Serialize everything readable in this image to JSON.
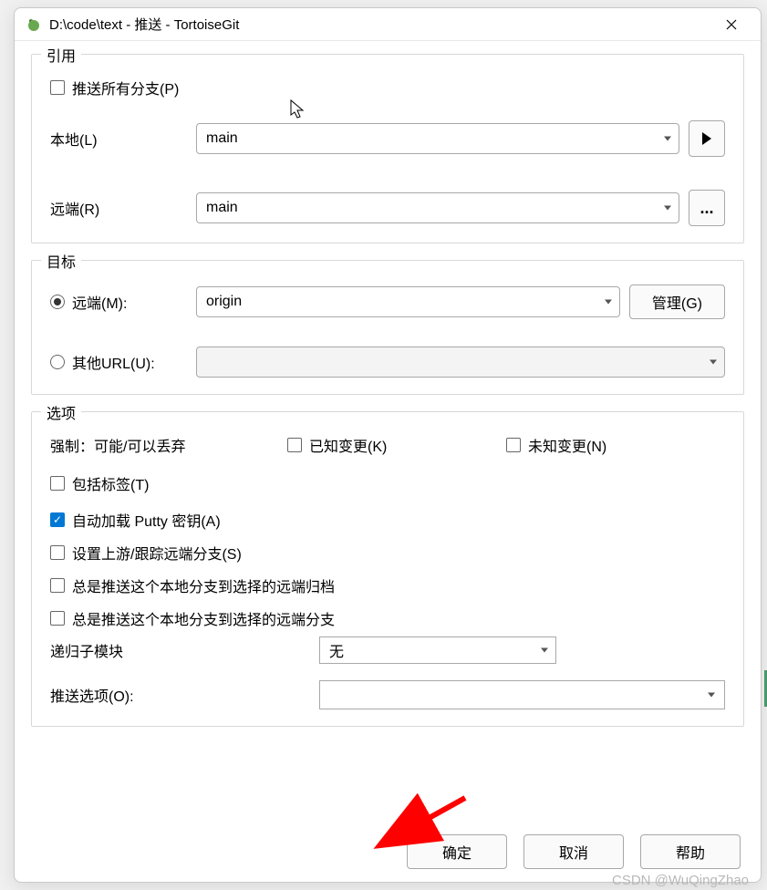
{
  "window": {
    "title": "D:\\code\\text - 推送 - TortoiseGit"
  },
  "ref": {
    "title": "引用",
    "push_all_label": "推送所有分支(P)",
    "push_all_checked": false,
    "local_label": "本地(L)",
    "local_value": "main",
    "remote_label": "远端(R)",
    "remote_value": "main"
  },
  "dest": {
    "title": "目标",
    "remote_radio_label": "远端(M):",
    "remote_radio_selected": true,
    "remote_value": "origin",
    "manage_label": "管理(G)",
    "url_radio_label": "其他URL(U):",
    "url_radio_selected": false,
    "url_value": ""
  },
  "opts": {
    "title": "选项",
    "force_label": "强制：可能/可以丢弃",
    "known_label": "已知变更(K)",
    "known_checked": false,
    "unknown_label": "未知变更(N)",
    "unknown_checked": false,
    "include_tags_label": "包括标签(T)",
    "include_tags_checked": false,
    "autoload_putty_label": "自动加载 Putty 密钥(A)",
    "autoload_putty_checked": true,
    "set_upstream_label": "设置上游/跟踪远端分支(S)",
    "set_upstream_checked": false,
    "always_push_archive_label": "总是推送这个本地分支到选择的远端归档",
    "always_push_archive_checked": false,
    "always_push_branch_label": "总是推送这个本地分支到选择的远端分支",
    "always_push_branch_checked": false,
    "recurse_label": "递归子模块",
    "recurse_value": "无",
    "push_option_label": "推送选项(O):",
    "push_option_value": ""
  },
  "buttons": {
    "ok": "确定",
    "cancel": "取消",
    "help": "帮助"
  },
  "watermark": "CSDN @WuQingZhao"
}
